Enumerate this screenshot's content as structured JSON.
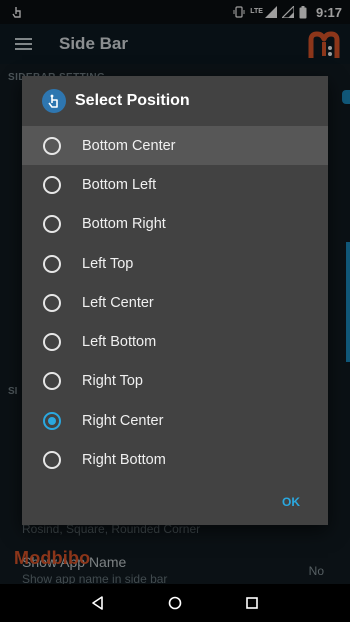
{
  "status_bar": {
    "lte": "LTE",
    "time": "9:17",
    "icons": [
      "touch-icon",
      "vibrate-icon",
      "signal-icon",
      "signal-icon",
      "battery-icon"
    ]
  },
  "app_bar": {
    "title": "Side Bar",
    "logo": "m-logo"
  },
  "background": {
    "section1_header": "SIDEBAR SETTING",
    "section2_header": "SI",
    "row1_subtitle": "Rosind, Square, Rounded Corner",
    "row2_title": "Show App Name",
    "row2_subtitle": "Show app name in side bar",
    "row2_value": "No",
    "watermark": "Modbibo"
  },
  "dialog": {
    "title": "Select Position",
    "icon": "touch-hand-icon",
    "options": [
      {
        "label": "Bottom Center",
        "checked": false
      },
      {
        "label": "Bottom Left",
        "checked": false
      },
      {
        "label": "Bottom Right",
        "checked": false
      },
      {
        "label": "Left Top",
        "checked": false
      },
      {
        "label": "Left Center",
        "checked": false
      },
      {
        "label": "Left Bottom",
        "checked": false
      },
      {
        "label": "Right Top",
        "checked": false
      },
      {
        "label": "Right Center",
        "checked": true
      },
      {
        "label": "Right Bottom",
        "checked": false
      }
    ],
    "ok_label": "OK"
  },
  "nav_bar": {
    "icons": [
      "back-icon",
      "home-icon",
      "recents-icon"
    ]
  },
  "colors": {
    "accent": "#2aa8e0",
    "dialog_bg": "#424242",
    "logo": "#e2572b"
  }
}
